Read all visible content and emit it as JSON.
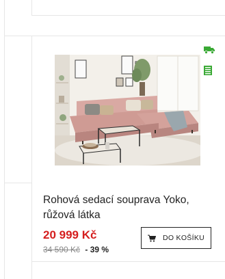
{
  "product": {
    "title": "Rohová sedací souprava Yoko, růžová látka",
    "price": "20 999 Kč",
    "old_price": "34 590 Kč",
    "discount": "- 39 %",
    "add_to_cart_label": "DO KOŠÍKU",
    "image_alt": "sofa-photo"
  },
  "icons": {
    "delivery": "truck-icon",
    "stock": "stock-icon",
    "cart": "cart-icon"
  },
  "colors": {
    "price": "#d51e1e",
    "accent_green": "#3aa935",
    "border": "#e6e6e6"
  }
}
